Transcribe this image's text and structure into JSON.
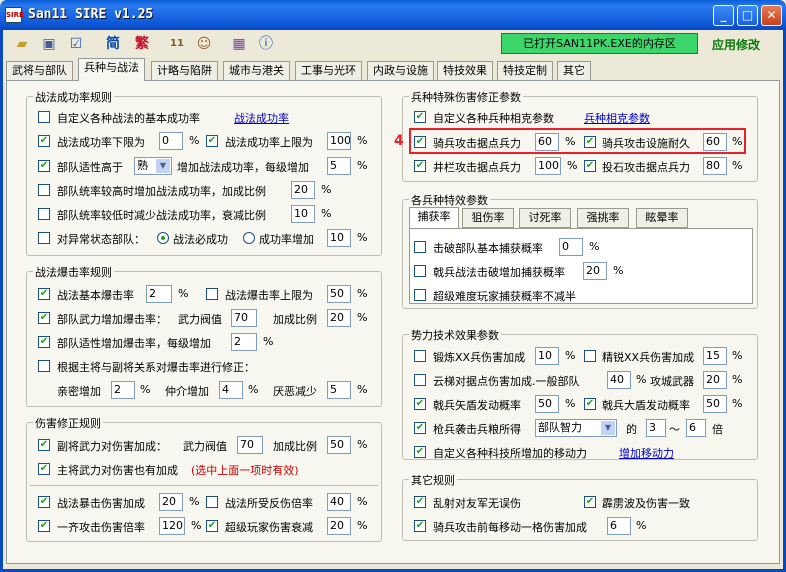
{
  "window": {
    "title": "San11 SIRE v1.25",
    "app_icon": "SIRE",
    "status": "已打开SAN11PK.EXE的内存区",
    "apply_label": "应用修改"
  },
  "toolbar": {
    "simplified": "简",
    "traditional": "繁",
    "num11": "11"
  },
  "tabs": [
    "武将与部队",
    "兵种与战法",
    "计略与陷阱",
    "城市与港关",
    "工事与光环",
    "内政与设施",
    "特技效果",
    "特技定制",
    "其它"
  ],
  "g1": {
    "title": "战法成功率规则",
    "r1": {
      "label": "自定义各种战法的基本成功率",
      "link": "战法成功率"
    },
    "r2": {
      "a": "战法成功率下限为",
      "av": "0",
      "b": "战法成功率上限为",
      "bv": "100",
      "pct": "%"
    },
    "r3": {
      "a": "部队适性高于",
      "sel": "熟",
      "b": "增加战法成功率，每级增加",
      "v": "5"
    },
    "r4": {
      "a": "部队统率较高时增加战法成功率，加成比例",
      "v": "20"
    },
    "r5": {
      "a": "部队统率较低时减少战法成功率，衰减比例",
      "v": "10"
    },
    "r6": {
      "a": "对异常状态部队：",
      "o1": "战法必成功",
      "o2": "成功率增加",
      "v": "10"
    }
  },
  "g2": {
    "title": "战法爆击率规则",
    "r1": {
      "a": "战法基本爆击率",
      "av": "2",
      "b": "战法爆击率上限为",
      "bv": "50"
    },
    "r2": {
      "a": "部队武力增加爆击率：",
      "b": "武力阀值",
      "bv": "70",
      "c": "加成比例",
      "cv": "20"
    },
    "r3": {
      "a": "部队适性增加爆击率，每级增加",
      "v": "2"
    },
    "r4": {
      "a": "根据主将与副将关系对爆击率进行修正："
    },
    "r5": {
      "a": "亲密增加",
      "av": "2",
      "b": "仲介增加",
      "bv": "4",
      "c": "厌恶减少",
      "cv": "5"
    }
  },
  "g3": {
    "title": "伤害修正规则",
    "r1": {
      "a": "副将武力对伤害加成：",
      "b": "武力阀值",
      "bv": "70",
      "c": "加成比例",
      "cv": "50"
    },
    "r2": {
      "a": "主将武力对伤害也有加成",
      "note": "(选中上面一项时有效)"
    },
    "r3": {
      "a": "战法暴击伤害加成",
      "av": "20",
      "b": "战法所受反伤倍率",
      "bv": "40"
    },
    "r4": {
      "a": "一齐攻击伤害倍率",
      "av": "120",
      "b": "超级玩家伤害衰减",
      "bv": "20"
    }
  },
  "g4": {
    "title": "兵种特殊伤害修正参数",
    "r1": {
      "a": "自定义各种兵种相克参数",
      "link": "兵种相克参数"
    },
    "marker": "4",
    "r2": {
      "a": "骑兵攻击据点兵力",
      "av": "60",
      "b": "骑兵攻击设施耐久",
      "bv": "60"
    },
    "r3": {
      "a": "井栏攻击据点兵力",
      "av": "100",
      "b": "投石攻击据点兵力",
      "bv": "80"
    }
  },
  "g5": {
    "title": "各兵种特效参数",
    "subtabs": [
      "捕获率",
      "狙伤率",
      "讨死率",
      "强挑率",
      "眩晕率"
    ],
    "r1": {
      "a": "击破部队基本捕获概率",
      "v": "0"
    },
    "r2": {
      "a": "戟兵战法击破增加捕获概率",
      "v": "20"
    },
    "r3": {
      "a": "超级难度玩家捕获概率不减半"
    }
  },
  "g6": {
    "title": "势力技术效果参数",
    "r1": {
      "a": "锻炼XX兵伤害加成",
      "av": "10",
      "b": "精锐XX兵伤害加成",
      "bv": "15"
    },
    "r2": {
      "a": "云梯对据点伤害加成.一般部队",
      "av": "40",
      "b": "攻城武器",
      "bv": "20"
    },
    "r3": {
      "a": "戟兵矢盾发动概率",
      "av": "50",
      "b": "戟兵大盾发动概率",
      "bv": "50"
    },
    "r4": {
      "a": "枪兵袭击兵粮所得",
      "sel": "部队智力",
      "b": "的",
      "v1": "3",
      "tilde": "～",
      "v2": "6",
      "c": "倍"
    },
    "r5": {
      "a": "自定义各种科技所增加的移动力",
      "link": "增加移动力"
    }
  },
  "g7": {
    "title": "其它规则",
    "r1": {
      "a": "乱射对友军无误伤",
      "b": "霹雳波及伤害一致"
    },
    "r2": {
      "a": "骑兵攻击前每移动一格伤害加成",
      "v": "6"
    }
  },
  "check": "✔",
  "pct": "%"
}
